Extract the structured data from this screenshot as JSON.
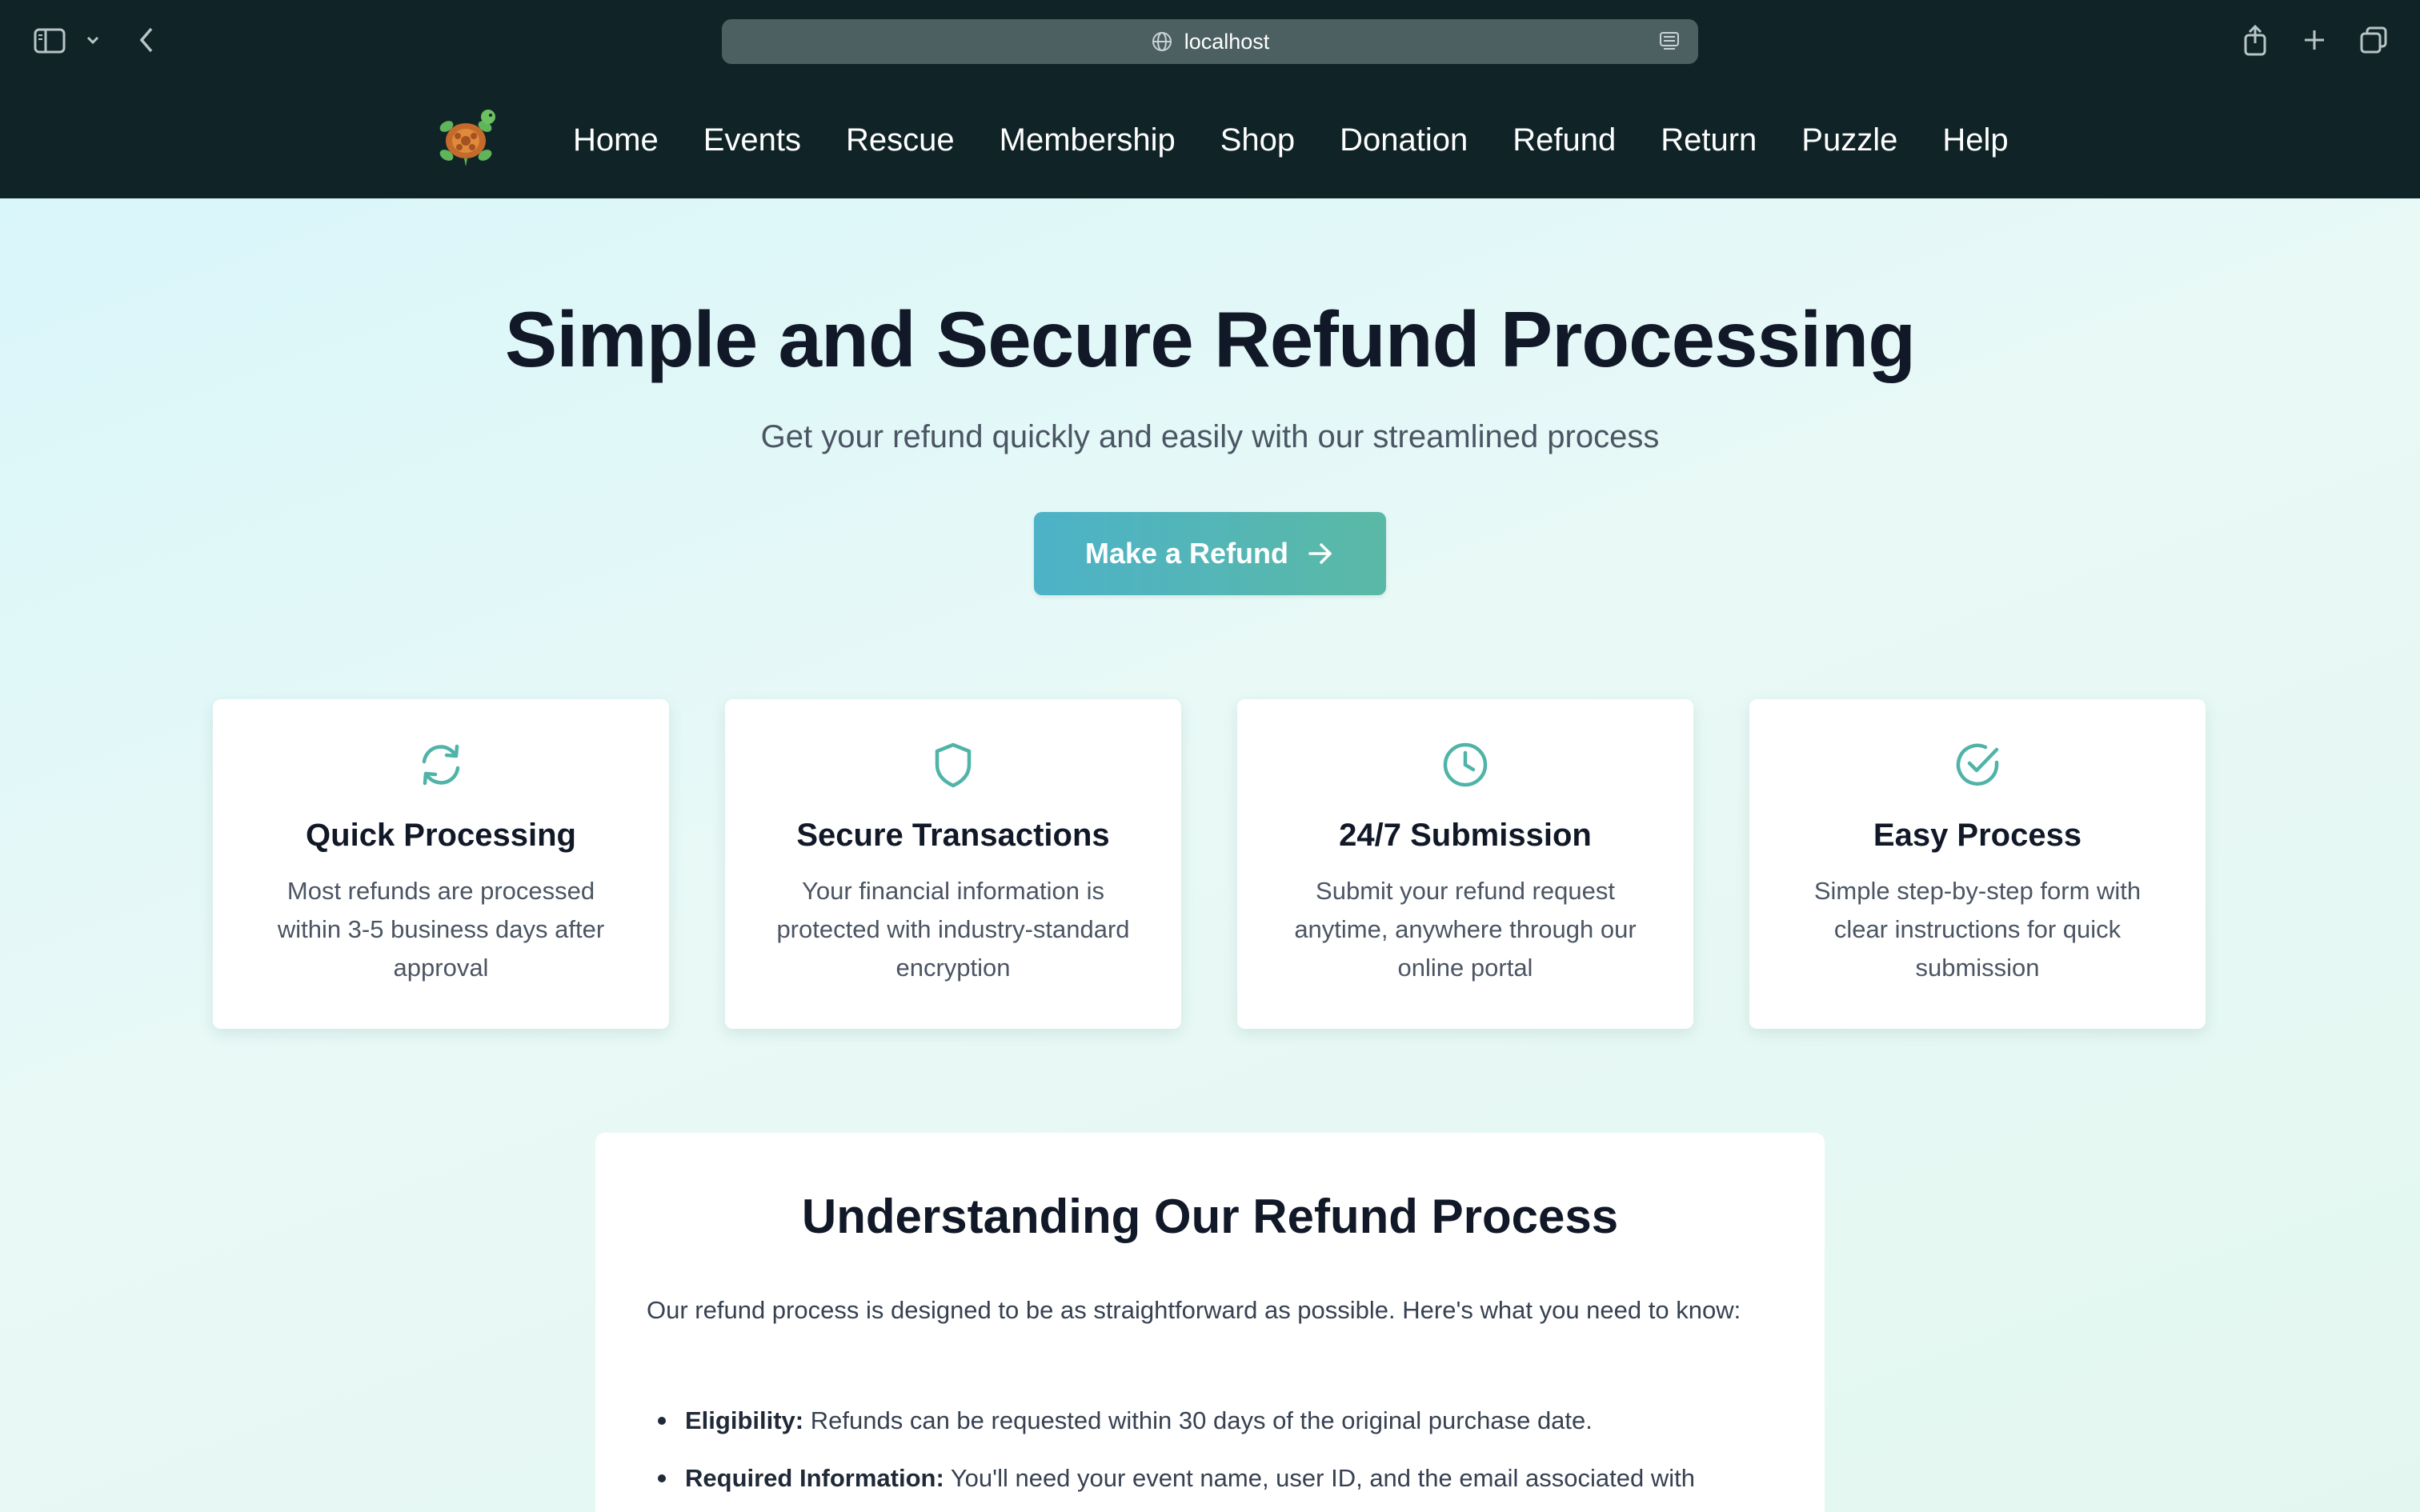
{
  "browser": {
    "url": "localhost"
  },
  "nav": {
    "links": [
      "Home",
      "Events",
      "Rescue",
      "Membership",
      "Shop",
      "Donation",
      "Refund",
      "Return",
      "Puzzle",
      "Help"
    ]
  },
  "hero": {
    "title": "Simple and Secure Refund Processing",
    "subtitle": "Get your refund quickly and easily with our streamlined process",
    "cta_label": "Make a Refund"
  },
  "features": [
    {
      "icon": "refresh-icon",
      "title": "Quick Processing",
      "description": "Most refunds are processed within 3-5 business days after approval"
    },
    {
      "icon": "shield-icon",
      "title": "Secure Transactions",
      "description": "Your financial information is protected with industry-standard encryption"
    },
    {
      "icon": "clock-icon",
      "title": "24/7 Submission",
      "description": "Submit your refund request anytime, anywhere through our online portal"
    },
    {
      "icon": "check-circle-icon",
      "title": "Easy Process",
      "description": "Simple step-by-step form with clear instructions for quick submission"
    }
  ],
  "info": {
    "title": "Understanding Our Refund Process",
    "intro": "Our refund process is designed to be as straightforward as possible. Here's what you need to know:",
    "items": [
      {
        "label": "Eligibility:",
        "text": "Refunds can be requested within 30 days of the original purchase date."
      },
      {
        "label": "Required Information:",
        "text": "You'll need your event name, user ID, and the email associated with"
      }
    ]
  },
  "colors": {
    "chrome_bg": "#102428",
    "accent": "#4fb3a8",
    "cta_start": "#4db2c8",
    "cta_end": "#5ab9a5"
  }
}
